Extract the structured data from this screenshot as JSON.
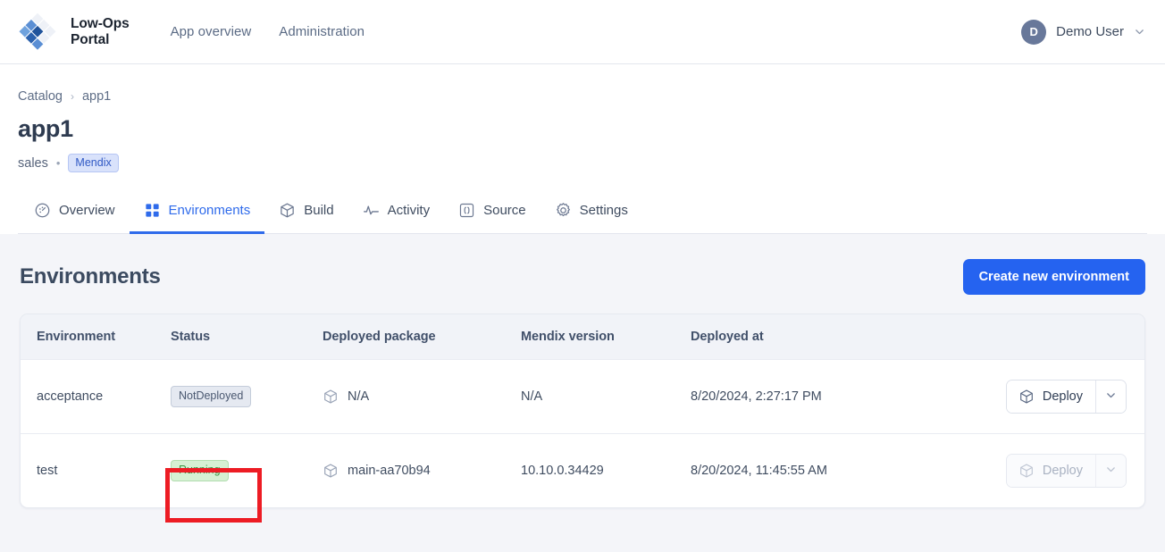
{
  "topnav": {
    "logo_icon": "diamond-grid-logo",
    "brand_line1": "Low-Ops",
    "brand_line2": "Portal",
    "links": [
      {
        "label": "App overview"
      },
      {
        "label": "Administration"
      }
    ],
    "user": {
      "initial": "D",
      "name": "Demo User",
      "chevron_icon": "chevron-down-icon"
    }
  },
  "breadcrumb": {
    "root": "Catalog",
    "separator": "›",
    "current": "app1"
  },
  "page": {
    "title": "app1",
    "owner": "sales",
    "dot": "•",
    "platform_chip": "Mendix"
  },
  "tabs": [
    {
      "label": "Overview",
      "icon": "gauge-icon",
      "active": false
    },
    {
      "label": "Environments",
      "icon": "grid-icon",
      "active": true
    },
    {
      "label": "Build",
      "icon": "package-icon",
      "active": false
    },
    {
      "label": "Activity",
      "icon": "pulse-icon",
      "active": false
    },
    {
      "label": "Source",
      "icon": "code-brackets-icon",
      "active": false
    },
    {
      "label": "Settings",
      "icon": "gear-icon",
      "active": false
    }
  ],
  "section": {
    "title": "Environments",
    "create_button": "Create new environment"
  },
  "table": {
    "columns": [
      "Environment",
      "Status",
      "Deployed package",
      "Mendix version",
      "Deployed at",
      ""
    ],
    "rows": [
      {
        "environment": "acceptance",
        "status": "NotDeployed",
        "status_kind": "notdeployed",
        "package": "N/A",
        "package_icon": "package-icon",
        "version": "N/A",
        "deployed_at": "8/20/2024, 2:27:17 PM",
        "action_label": "Deploy",
        "action_icon": "package-icon",
        "action_chevron": "chevron-down-icon",
        "action_disabled": false
      },
      {
        "environment": "test",
        "status": "Running",
        "status_kind": "running",
        "package": "main-aa70b94",
        "package_icon": "package-icon",
        "version": "10.10.0.34429",
        "deployed_at": "8/20/2024, 11:45:55 AM",
        "action_label": "Deploy",
        "action_icon": "package-icon",
        "action_chevron": "chevron-down-icon",
        "action_disabled": true
      }
    ]
  },
  "annotation": {
    "target": "running-status-badge",
    "color": "#ed1c24"
  },
  "colors": {
    "accent_blue": "#2563f0",
    "tab_active": "#2f6beb",
    "chip_mendix_bg": "#d9e2fb",
    "chip_mendix_text": "#2f58c4",
    "badge_running_bg": "#d6f0d3",
    "badge_running_text": "#3a9442",
    "badge_notdeployed_bg": "#e5e9f1",
    "badge_notdeployed_text": "#4a5870",
    "page_bg": "#f4f5f9",
    "annotation_red": "#ed1c24"
  }
}
